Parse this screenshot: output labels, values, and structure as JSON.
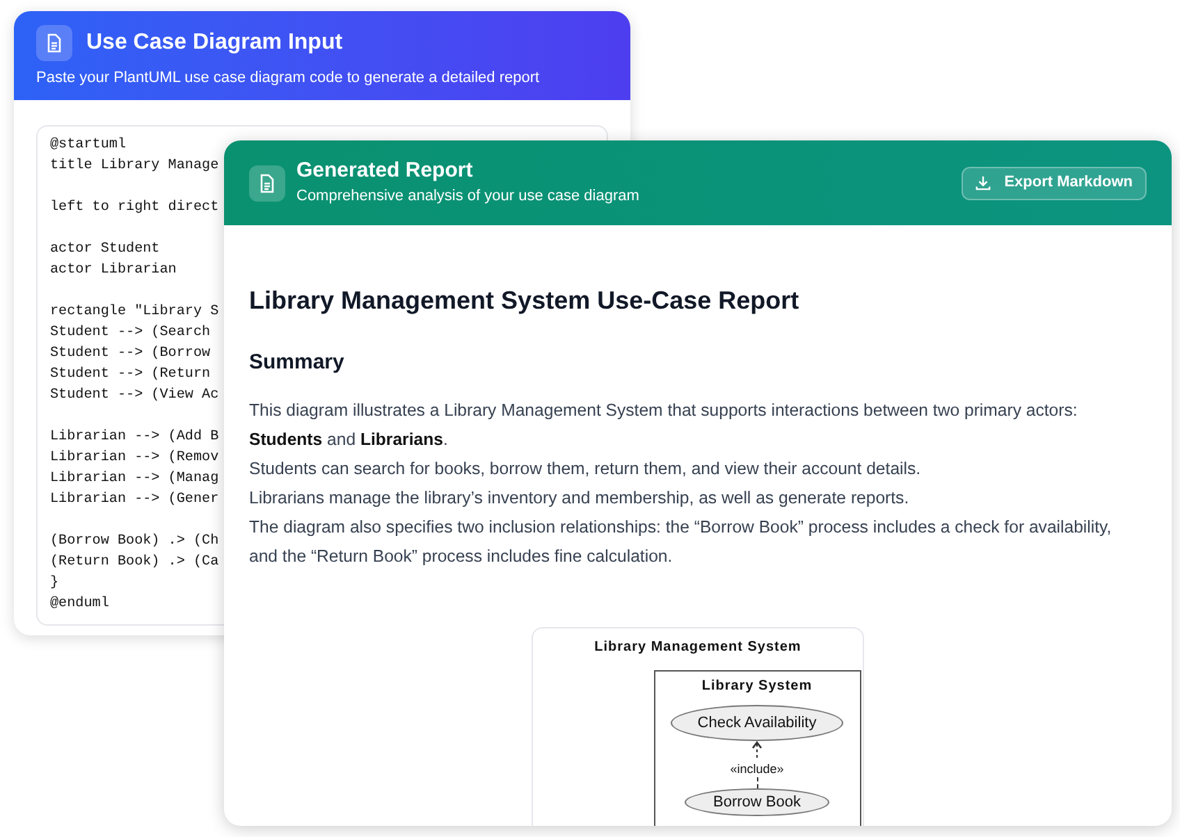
{
  "input_panel": {
    "title": "Use Case Diagram Input",
    "subtitle": "Paste your PlantUML use case diagram code to generate a detailed report",
    "code_blocks": [
      [
        "@startuml",
        "title Library Manage"
      ],
      [
        "left to right direct"
      ],
      [
        "actor Student",
        "actor Librarian"
      ],
      [
        "rectangle \"Library S",
        "Student --> (Search",
        "Student --> (Borrow",
        "Student --> (Return",
        "Student --> (View Ac"
      ],
      [
        "Librarian --> (Add B",
        "Librarian --> (Remov",
        "Librarian --> (Manag",
        "Librarian --> (Gener"
      ],
      [
        "(Borrow Book) .> (Ch",
        "(Return Book) .> (Ca",
        "}",
        "@enduml"
      ]
    ]
  },
  "report_panel": {
    "title": "Generated Report",
    "subtitle": "Comprehensive analysis of your use case diagram",
    "export_button": "Export Markdown",
    "heading": "Library Management System Use-Case Report",
    "section": "Summary",
    "paragraphs": [
      "This diagram illustrates a Library Management System that supports interactions between two primary actors: **Students** and **Librarians**.",
      "Students can search for books, borrow them, return them, and view their account details.",
      "Librarians manage the library’s inventory and membership, as well as generate reports.",
      "The diagram also specifies two inclusion relationships: the “Borrow Book” process includes a check for availability, and the “Return Book” process includes fine calculation."
    ],
    "diagram": {
      "title": "Library Management System",
      "boundary": "Library System",
      "use_case_top": "Check Availability",
      "relation": "«include»",
      "use_case_bottom": "Borrow Book"
    }
  }
}
